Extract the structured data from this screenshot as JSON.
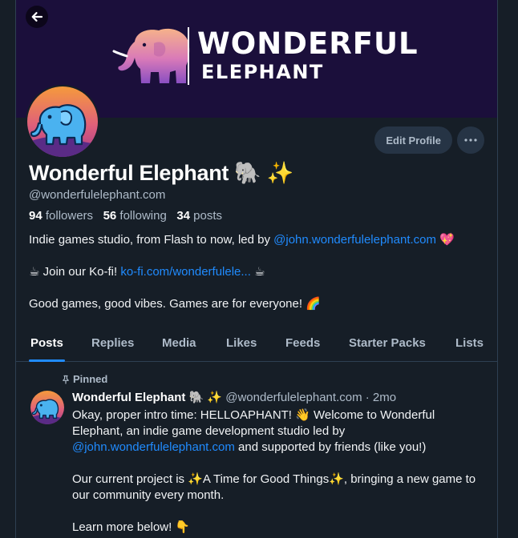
{
  "banner": {
    "title_line1": "WONDERFUL",
    "title_line2": "ELEPHANT"
  },
  "profile": {
    "display_name": "Wonderful Elephant 🐘 ✨",
    "handle": "@wonderfulelephant.com",
    "followers_count": "94",
    "followers_label": "followers",
    "following_count": "56",
    "following_label": "following",
    "posts_count": "34",
    "posts_label": "posts",
    "edit_profile_label": "Edit Profile",
    "bio": {
      "line1_prefix": "Indie games studio, from Flash to now, led by ",
      "line1_link": "@john.wonderfulelephant.com",
      "line1_suffix": " 💖",
      "line2_prefix": "☕ Join our Ko-fi! ",
      "line2_link": "ko-fi.com/wonderfulele...",
      "line2_suffix": " ☕",
      "line3": "Good games, good vibes. Games are for everyone! 🌈"
    }
  },
  "tabs": [
    {
      "label": "Posts",
      "active": true
    },
    {
      "label": "Replies"
    },
    {
      "label": "Media"
    },
    {
      "label": "Likes"
    },
    {
      "label": "Feeds"
    },
    {
      "label": "Starter Packs"
    },
    {
      "label": "Lists"
    }
  ],
  "pinned_post": {
    "pinned_label": "Pinned",
    "author": "Wonderful Elephant 🐘 ✨",
    "handle": "@wonderfulelephant.com",
    "separator": " · ",
    "time": "2mo",
    "p1_a": "Okay, proper intro time: HELLOAPHANT! 👋 Welcome to Wonderful Elephant, an indie game development studio led by ",
    "p1_link": "@john.wonderfulelephant.com",
    "p1_b": " and supported by friends (like you!)",
    "p2": "Our current project is ✨A Time for Good Things✨, bringing a new game to our community every month.",
    "p3": "Learn more below! 👇"
  },
  "colors": {
    "background": "#161e27",
    "banner": "#1b0f3b",
    "accent_link": "#208bfe",
    "muted_text": "#aebbc9",
    "button_bg": "#263445"
  },
  "icons": [
    "back-arrow-icon",
    "more-dots-icon",
    "pin-icon",
    "elephant-logo-icon"
  ]
}
